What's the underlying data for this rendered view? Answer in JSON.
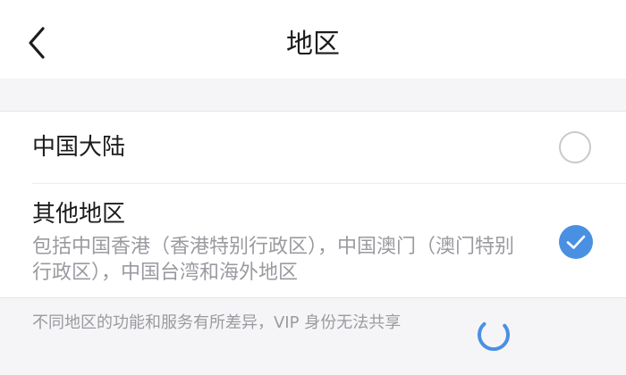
{
  "header": {
    "title": "地区",
    "back_icon": "chevron-left-icon"
  },
  "regions": [
    {
      "label": "中国大陆",
      "description": "",
      "selected": false
    },
    {
      "label": "其他地区",
      "description": "包括中国香港（香港特别行政区），中国澳门（澳门特别行政区），中国台湾和海外地区",
      "selected": true
    }
  ],
  "footer": {
    "note": "不同地区的功能和服务有所差异，VIP 身份无法共享"
  },
  "colors": {
    "accent": "#4a90e2",
    "text_primary": "#1c1c1e",
    "text_secondary": "#9a9aa0",
    "background": "#f5f5f7"
  }
}
